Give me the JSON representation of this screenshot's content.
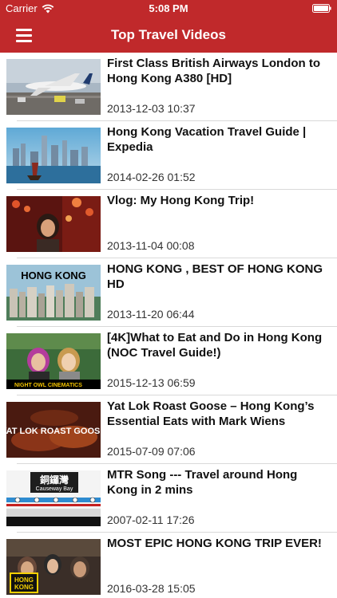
{
  "status_bar": {
    "carrier": "Carrier",
    "time": "5:08 PM",
    "wifi_icon": "wifi-icon",
    "battery_icon": "battery-icon"
  },
  "nav": {
    "title": "Top Travel Videos",
    "menu_icon": "hamburger-menu-icon",
    "bar_color": "#c0292b"
  },
  "thumbnail_captions": {
    "hong_kong_banner": "HONG KONG",
    "night_owl": "NIGHT OWL CINEMATICS",
    "roast_goose": "YAT LOK ROAST GOOSE",
    "mtr_chinese": "銅鑼灣",
    "mtr_english": "Causeway Bay",
    "epic_logo_top": "HONG",
    "epic_logo_bottom": "KONG"
  },
  "videos": [
    {
      "title": "First Class British Airways London to Hong Kong A380 [HD]",
      "date": "2013-12-03 10:37"
    },
    {
      "title": "Hong Kong Vacation Travel Guide | Expedia",
      "date": "2014-02-26 01:52"
    },
    {
      "title": "Vlog: My Hong Kong Trip!",
      "date": "2013-11-04 00:08"
    },
    {
      "title": "HONG KONG , BEST OF HONG KONG HD",
      "date": "2013-11-20 06:44"
    },
    {
      "title": "[4K]What to Eat and Do in Hong Kong (NOC Travel Guide!)",
      "date": "2015-12-13 06:59"
    },
    {
      "title": "Yat Lok Roast Goose – Hong Kong’s Essential Eats with Mark Wiens",
      "date": "2015-07-09 07:06"
    },
    {
      "title": "MTR Song --- Travel around Hong Kong in 2 mins",
      "date": "2007-02-11 17:26"
    },
    {
      "title": "MOST EPIC HONG KONG TRIP EVER!",
      "date": "2016-03-28 15:05"
    }
  ]
}
